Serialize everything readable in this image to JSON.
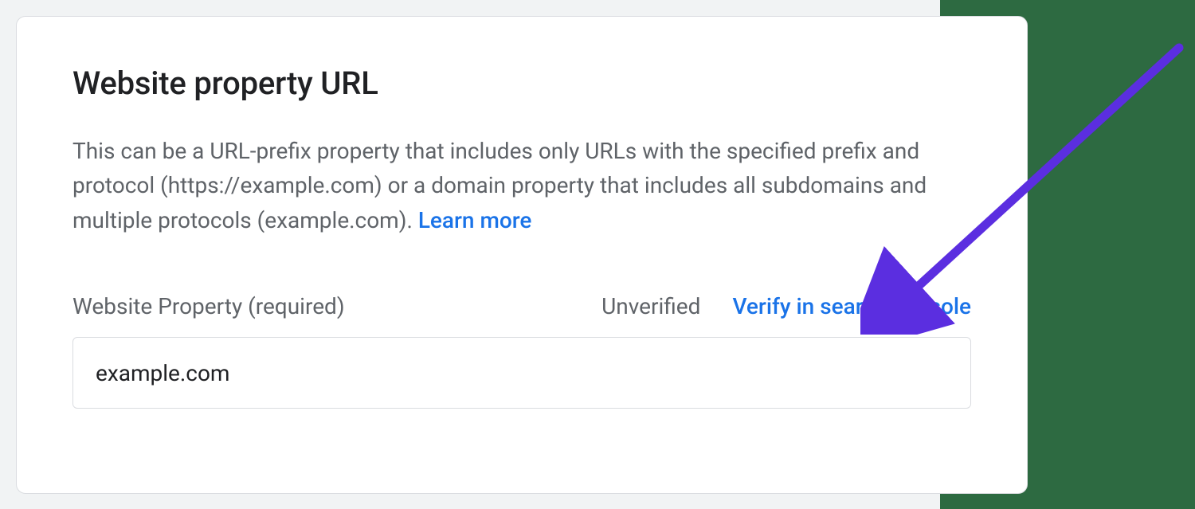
{
  "card": {
    "title": "Website property URL",
    "description_pre": "This can be a URL-prefix property that includes only URLs with the specified prefix and protocol (https://example.com) or a domain property that includes all subdomains and multiple protocols (example.com). ",
    "learn_more": "Learn more"
  },
  "field": {
    "label": "Website Property (required)",
    "status": "Unverified",
    "verify_link": "Verify in search console",
    "value": "example.com"
  },
  "annotation": {
    "arrow_color": "#5b2ee0"
  }
}
